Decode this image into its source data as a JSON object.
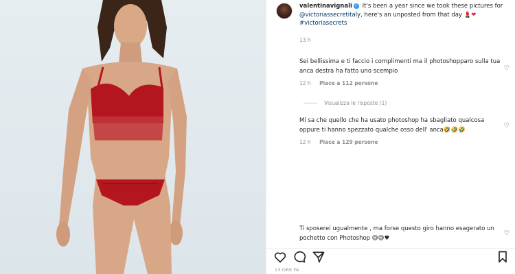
{
  "post": {
    "username": "valentinavignali",
    "caption_pre": " It's been a year since we took these pictures for ",
    "mention": "@victoriassecretitaly",
    "caption_post": ", here's an unposted from that day ",
    "caption_emoji": "💄❤",
    "hashtag": "#victoriasecrets",
    "caption_time": "13 h",
    "post_time": "13 ORE FA"
  },
  "comments": [
    {
      "text": "Sei bellissima e ti faccio i complimenti ma il photoshopparo sulla tua anca destra ha fatto uno scempio",
      "time": "12 h",
      "likes": "Piace a 112 persone"
    },
    {
      "text": "Mi sa che quello che ha usato photoshop ha sbagliato qualcosa oppure ti hanno spezzato qualche osso dell' anca🤣🤣🤣",
      "time": "12 h",
      "likes": "Piace a 129 persone"
    },
    {
      "text": "Ti sposerei ugualmente , ma forse questo giro hanno esagerato un pochetto con Photoshop 😅😅♥"
    }
  ],
  "view_replies": "Visualizza le risposte (1)",
  "icons": {
    "like": "heart-icon",
    "comment": "comment-icon",
    "share": "share-icon",
    "save": "bookmark-icon",
    "verified": "verified-badge-icon",
    "comment_like": "heart-icon"
  },
  "colors": {
    "link": "#00376b",
    "lingerie": "#b3161f",
    "background_photo": "#e2e9ee"
  }
}
